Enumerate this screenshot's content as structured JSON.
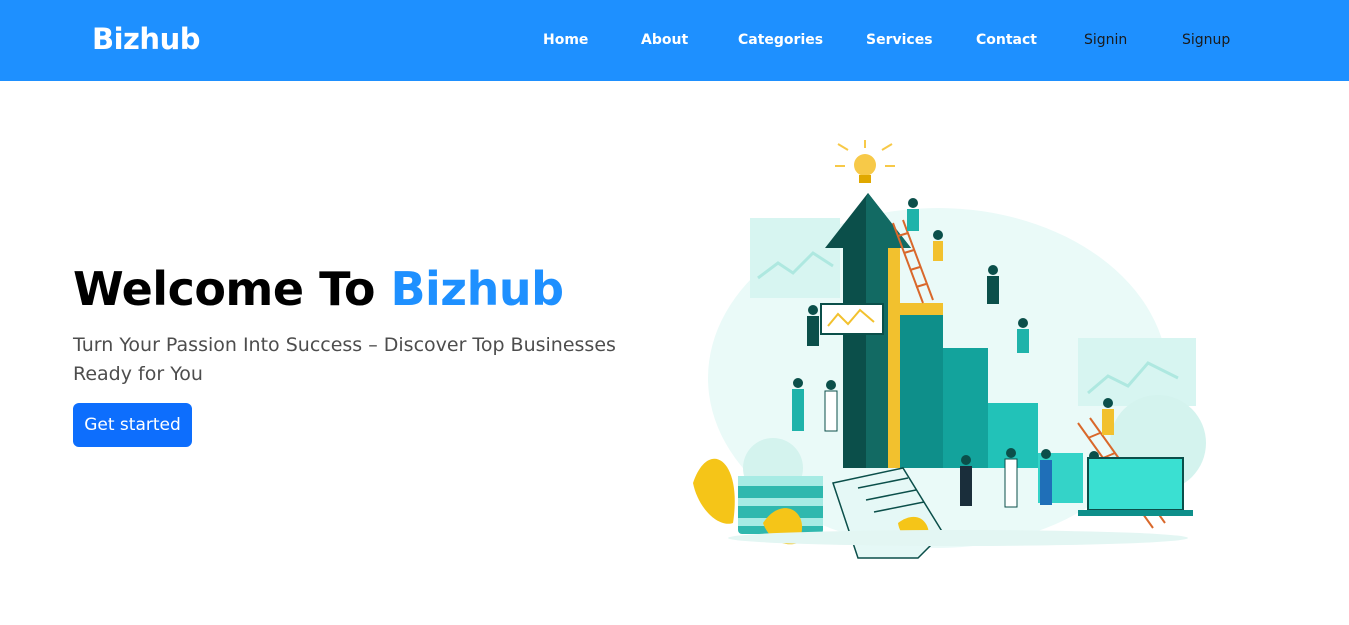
{
  "navbar": {
    "brand": "Bizhub",
    "links": [
      {
        "label": "Home"
      },
      {
        "label": "About"
      },
      {
        "label": "Categories"
      },
      {
        "label": "Services"
      },
      {
        "label": "Contact"
      },
      {
        "label": "Signin"
      },
      {
        "label": "Signup"
      }
    ]
  },
  "hero": {
    "title_prefix": "Welcome To ",
    "title_accent": "Bizhub",
    "subtitle": "Turn Your Passion Into Success – Discover Top Businesses Ready for You",
    "cta_label": "Get started",
    "illustration_icon": "business-growth-illustration"
  },
  "colors": {
    "primary": "#1e90ff",
    "button": "#0d6efd",
    "nav_text": "#ffffff",
    "nav_text_dark": "#1a1a1a",
    "teal": "#0e8f8a",
    "dark_teal": "#0b4f4a",
    "yellow": "#f5c518"
  }
}
